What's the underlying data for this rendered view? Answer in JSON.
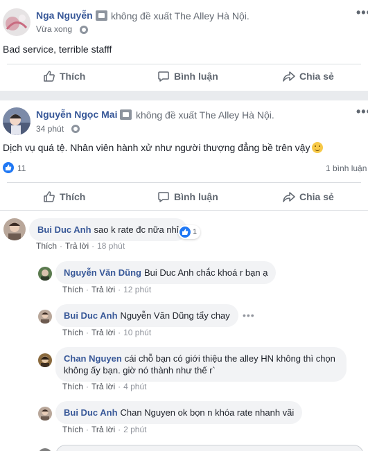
{
  "colors": {
    "link_blue": "#385898",
    "like_blue": "#2078f4",
    "muted": "#606770",
    "bubble": "#f2f3f5"
  },
  "post1": {
    "author": "Nga Nguyễn",
    "verb": "không đề xuất The Alley Hà Nội.",
    "time": "Vừa xong",
    "text": "Bad service, terrible stafff",
    "actions": {
      "like": "Thích",
      "comment": "Bình luận",
      "share": "Chia sẻ"
    }
  },
  "post2": {
    "author": "Nguyễn Ngọc Mai",
    "verb": "không đề xuất The Alley Hà Nội.",
    "time": "34 phút",
    "text": "Dịch vụ quá tệ. Nhân viên hành xử như người thượng đẳng bề trên vậy",
    "reaction_count": "11",
    "comment_count": "1 bình luận",
    "actions": {
      "like": "Thích",
      "comment": "Bình luận",
      "share": "Chia sẻ"
    }
  },
  "comments": [
    {
      "name": "Bui Duc Anh",
      "text": "sao k rate đc nữa nhỉ",
      "like": "Thích",
      "reply": "Trả lời",
      "time": "18 phút",
      "reactions": "1"
    },
    {
      "name": "Nguyễn Văn Dũng",
      "text": "Bui Duc Anh chắc khoá r bạn ạ",
      "like": "Thích",
      "reply": "Trả lời",
      "time": "12 phút"
    },
    {
      "name": "Bui Duc Anh",
      "text": "Nguyễn Văn Dũng tẩy chay",
      "like": "Thích",
      "reply": "Trả lời",
      "time": "10 phút"
    },
    {
      "name": "Chan Nguyen",
      "text": "cái chỗ bạn có giới thiệu the alley HN không thì chọn",
      "text2": "không ấy bạn. giờ nó thành như thế r`",
      "like": "Thích",
      "reply": "Trả lời",
      "time": "4 phút"
    },
    {
      "name": "Bui Duc Anh",
      "text": "Chan Nguyen ok bọn n khóa rate nhanh vãi",
      "like": "Thích",
      "reply": "Trả lời",
      "time": "2 phút"
    }
  ]
}
